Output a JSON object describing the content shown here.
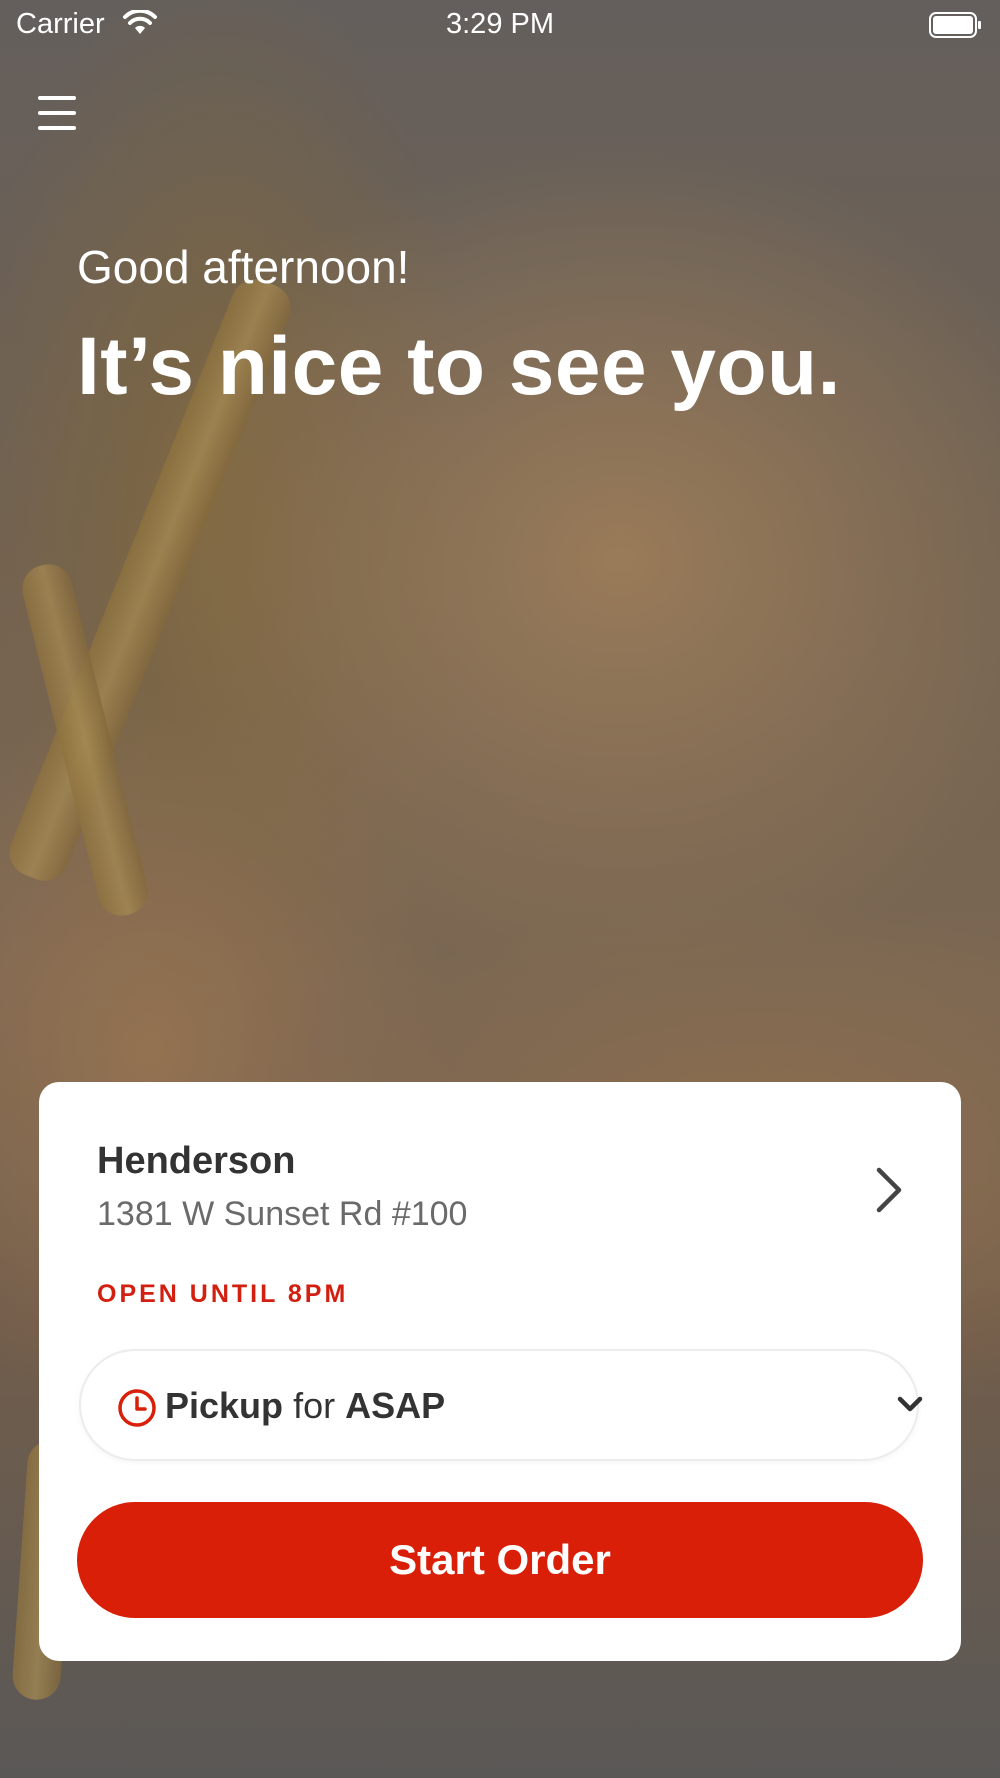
{
  "status_bar": {
    "carrier": "Carrier",
    "time": "3:29 PM"
  },
  "hero": {
    "greeting": "Good afternoon!",
    "headline": "It’s nice to see you."
  },
  "store": {
    "name": "Henderson",
    "address": "1381 W Sunset Rd #100",
    "hours": "OPEN UNTIL 8PM"
  },
  "order_mode": {
    "mode": "Pickup",
    "connector": "for",
    "time": "ASAP"
  },
  "cta": {
    "label": "Start Order"
  },
  "icons": {
    "menu": "hamburger-menu-icon",
    "store_link": "chevron-right-icon",
    "time": "clock-icon",
    "dropdown": "chevron-down-icon",
    "signal": "wifi-icon",
    "battery": "battery-icon"
  },
  "colors": {
    "accent": "#d91f07",
    "hours_text": "#d21f10",
    "card_bg": "#ffffff",
    "text_primary": "#333333",
    "text_secondary": "#6a6a6a"
  }
}
